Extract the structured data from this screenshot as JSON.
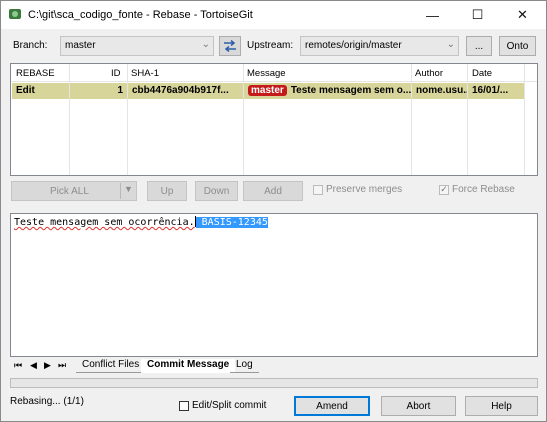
{
  "window": {
    "title": "C:\\git\\sca_codigo_fonte - Rebase - TortoiseGit"
  },
  "titlebar": {
    "minimize": "—",
    "maximize": "☐",
    "close": "✕"
  },
  "branch": {
    "label": "Branch:",
    "value": "master"
  },
  "upstream": {
    "label": "Upstream:",
    "value": "remotes/origin/master",
    "browse": "...",
    "onto": "Onto"
  },
  "table": {
    "columns": [
      "REBASE",
      "ID",
      "SHA-1",
      "Message",
      "Author",
      "Date"
    ],
    "rows": [
      {
        "rebase": "Edit",
        "id": "1",
        "sha": "cbb4476a904b917f...",
        "tag": "master",
        "message": "Teste mensagem sem o...",
        "author": "nome.usu...",
        "date": "16/01/..."
      }
    ]
  },
  "actions": {
    "pick_all": "Pick ALL",
    "up": "Up",
    "down": "Down",
    "add": "Add",
    "preserve_merges": "Preserve merges",
    "force_rebase": "Force Rebase"
  },
  "commit": {
    "message": "Teste mensagem sem ocorrência.",
    "issue": "BASIS-12345"
  },
  "tabs": {
    "conflict": "Conflict Files",
    "commit": "Commit Message",
    "log": "Log"
  },
  "footer": {
    "status": "Rebasing... (1/1)",
    "edit_split": "Edit/Split commit",
    "amend": "Amend",
    "abort": "Abort",
    "help": "Help"
  },
  "colors": {
    "row_highlight": "#d7d59a",
    "tag_bg": "#c41a1a",
    "selection": "#3399ff",
    "accent": "#0078d7"
  }
}
